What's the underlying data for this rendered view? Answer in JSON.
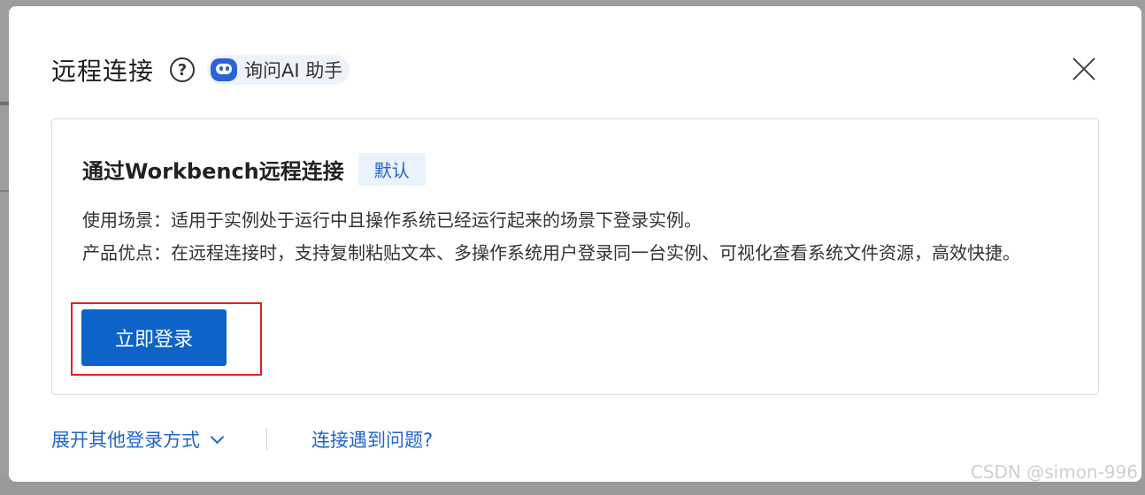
{
  "modal": {
    "title": "远程连接",
    "help_icon": "question-circle-icon",
    "ai_assistant_label": "询问AI 助手",
    "close_icon": "close-icon"
  },
  "card": {
    "title": "通过Workbench远程连接",
    "badge": "默认",
    "scenario": "使用场景：适用于实例处于运行中且操作系统已经运行起来的场景下登录实例。",
    "advantages": "产品优点：在远程连接时，支持复制粘贴文本、多操作系统用户登录同一台实例、可视化查看系统文件资源，高效快捷。",
    "login_button": "立即登录"
  },
  "footer": {
    "expand_label": "展开其他登录方式",
    "problem_link": "连接遇到问题?"
  },
  "watermark": "CSDN @simon-996",
  "colors": {
    "primary": "#0c63c8",
    "link": "#1f66c8",
    "highlight": "#e02020",
    "badge_bg": "#eaf2fc"
  }
}
